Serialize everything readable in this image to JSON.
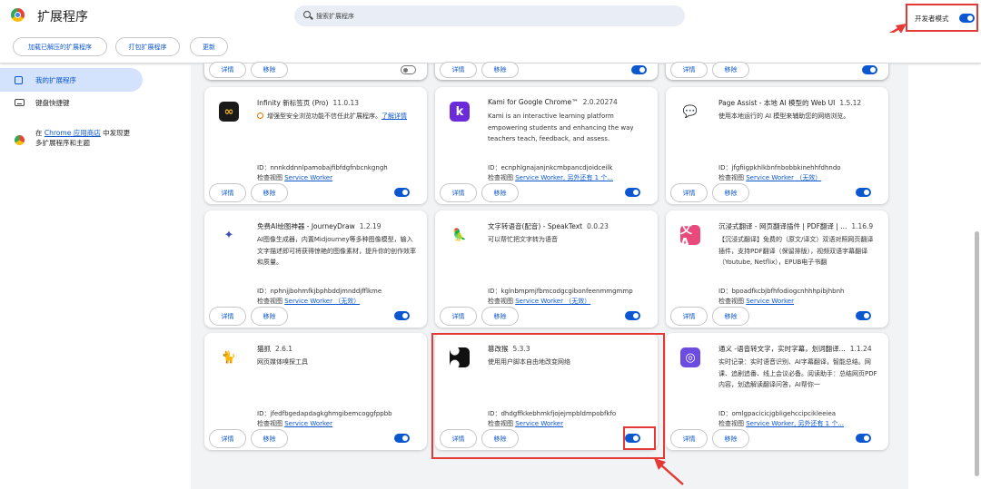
{
  "header": {
    "title": "扩展程序",
    "search_placeholder": "搜索扩展程序",
    "devmode_label": "开发者模式",
    "devmode_on": true
  },
  "toolbar": {
    "load_unpacked": "加载已解压的扩展程序",
    "pack": "打包扩展程序",
    "update": "更新"
  },
  "sidebar": {
    "my_extensions": "我的扩展程序",
    "shortcuts": "键盘快捷键",
    "webstore_prefix": "在 ",
    "webstore_link": "Chrome 应用商店",
    "webstore_suffix": " 中发现更多扩展程序和主题"
  },
  "card_buttons": {
    "details": "详情",
    "remove": "移除"
  },
  "id_prefix": "ID：",
  "view_prefix": "检查视图 ",
  "top_row_toggles": [
    false,
    true,
    true
  ],
  "extensions": [
    {
      "name": "Infinity 新标签页 (Pro)",
      "version": "11.0.13",
      "warning": "增强型安全浏览功能不信任此扩展程序。",
      "warning_link": "了解详情",
      "id": "nnnkddnnlpamobajfibfdgfnbcnkgngh",
      "view_link": "Service Worker",
      "icon_text": "∞",
      "icon_bg": "#1a1a1a",
      "icon_fg": "#f0b323",
      "enabled": true
    },
    {
      "name": "Kami for Google Chrome™",
      "version": "2.0.20274",
      "desc": "Kami is an interactive learning platform empowering students and enhancing the way teachers teach, feedback, and assess.",
      "id": "ecnphlgnajanjnkcmbpancdjoidceilk",
      "view_link": "Service Worker, 另外还有 1 个...",
      "icon_text": "k",
      "icon_bg": "#6b2bd9",
      "icon_fg": "#ffffff",
      "enabled": true
    },
    {
      "name": "Page Assist - 本地 AI 模型的 Web UI",
      "version": "1.5.12",
      "desc": "使用本地运行的 AI 模型来辅助您的网络浏览。",
      "id": "jfgfiigpkhlkbnfnbobbkinehhfdhndo",
      "view_link": "Service Worker （无效）",
      "icon_text": "💬",
      "icon_bg": "#ffffff",
      "icon_fg": "#333333",
      "enabled": true
    },
    {
      "name": "免费AI绘图神器 - JourneyDraw",
      "version": "1.2.19",
      "desc": "AI图像生成器，内置Midjourney等多种图像模型，输入文字描述即可将获得惊艳的图像素材，提升你的创作效率和质量。",
      "id": "nphnjjbohmfkjbphbddjmnddjfflkme",
      "view_link": "Service Worker （无效）",
      "icon_text": "✦",
      "icon_bg": "#ffffff",
      "icon_fg": "#3f51b5",
      "enabled": true
    },
    {
      "name": "文字转语音(配音) - SpeakText",
      "version": "0.0.23",
      "desc": "可以帮忙把文字转为语音",
      "id": "kglnbmpmjfbmcodgcgibonfeenmmgmmp",
      "view_link": "Service Worker （无效）",
      "icon_text": "🦜",
      "icon_bg": "#ffffff",
      "icon_fg": "#7cb342",
      "enabled": true
    },
    {
      "name": "沉浸式翻译 - 网页翻译插件 | PDF翻译 | ...",
      "version": "1.16.9",
      "desc": "【沉浸式翻译】免费的（原文/译文）双语对照网页翻译插件，支持PDF翻译（保留排版），视频双语字幕翻译（Youtube, Netflix），EPUB电子书翻",
      "id": "bpoadfkcbjbfhfodiogcnhhhpibjhbnh",
      "view_link": "Service Worker",
      "icon_text": "文A",
      "icon_bg": "#e94a7c",
      "icon_fg": "#ffffff",
      "enabled": true
    },
    {
      "name": "猫抓",
      "version": "2.6.1",
      "desc": "网页媒体嗅探工具",
      "id": "jfedfbgedapdagkghmgibemcoggfppbb",
      "view_link": "Service Worker",
      "icon_text": "🐈",
      "icon_bg": "#ffffff",
      "icon_fg": "#f5a623",
      "enabled": true
    },
    {
      "name": "篡改猴",
      "version": "5.3.3",
      "desc": "使用用户脚本自由地改变网络",
      "id": "dhdgffkkebhmkfjojejmpbldmpobfkfo",
      "view_link": "Service Worker",
      "icon_text": "● ●",
      "icon_bg": "#111111",
      "icon_fg": "#ffffff",
      "enabled": true
    },
    {
      "name": "通义 -语音转文字，实时字幕，划词翻译...",
      "version": "1.1.24",
      "desc": "实时记录：实时语音识别、AI字幕翻译，智能总结。网课、追剧追番、线上会议必备。阅读助手：总结网页PDF内容，划选解读翻译问答，AI帮你一",
      "id": "omlgpacicicjgbligehccipcikleeiea",
      "view_link": "Service Worker, 另外还有 1 个...",
      "icon_text": "◎",
      "icon_bg": "#6c4ce0",
      "icon_fg": "#ffffff",
      "enabled": true
    }
  ],
  "colors": {
    "accent": "#0b57d0",
    "highlight": "#e53935",
    "background": "#f1f3f4"
  }
}
